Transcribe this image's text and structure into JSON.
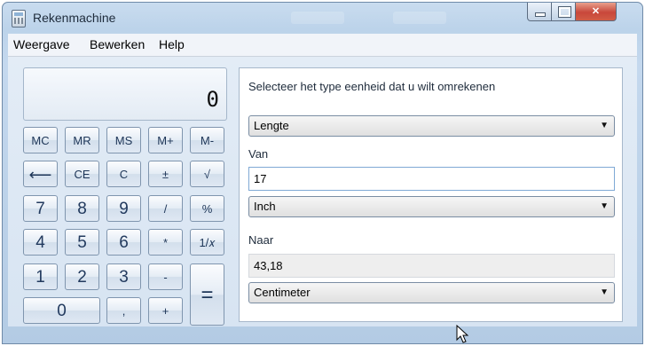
{
  "window": {
    "title": "Rekenmachine"
  },
  "menu": {
    "items": [
      "Weergave",
      "Bewerken",
      "Help"
    ]
  },
  "display": {
    "value": "0"
  },
  "keys": {
    "mc": "MC",
    "mr": "MR",
    "ms": "MS",
    "mplus": "M+",
    "mminus": "M-",
    "backspace": "⟵",
    "ce": "CE",
    "c": "C",
    "plusminus": "±",
    "sqrt": "√",
    "n7": "7",
    "n8": "8",
    "n9": "9",
    "divide": "/",
    "percent": "%",
    "n4": "4",
    "n5": "5",
    "n6": "6",
    "multiply": "*",
    "reciprocal": "1/𝑥",
    "n1": "1",
    "n2": "2",
    "n3": "3",
    "minus": "-",
    "equals": "=",
    "n0": "0",
    "decimal": ",",
    "plus": "+"
  },
  "converter": {
    "instruction": "Selecteer het type eenheid dat u wilt omrekenen",
    "type_selected": "Lengte",
    "from_label": "Van",
    "from_value": "17",
    "from_unit": "Inch",
    "to_label": "Naar",
    "to_value": "43,18",
    "to_unit": "Centimeter"
  },
  "icons": {
    "app": "calculator-icon",
    "minimize": "minimize-icon",
    "maximize": "maximize-icon",
    "close": "close-icon",
    "dropdown": "chevron-down-icon",
    "cursor": "mouse-pointer-icon"
  },
  "colors": {
    "close_button": "#c8473a",
    "window_frame": "#bcd3ea"
  }
}
